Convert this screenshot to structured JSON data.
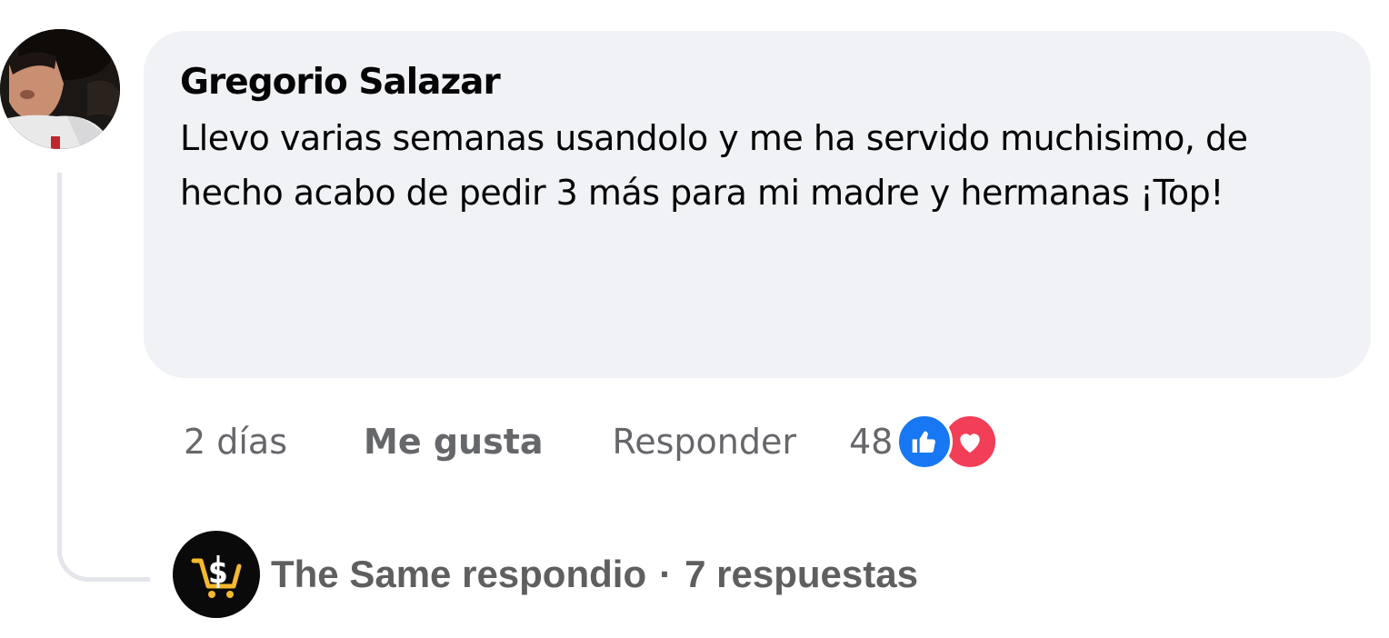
{
  "comment": {
    "author": "Gregorio Salazar",
    "text": "Llevo varias semanas usandolo y me ha servido muchisimo, de hecho acabo de pedir 3 más para mi madre y hermanas ¡Top!",
    "time": "2 días",
    "like_label": "Me gusta",
    "reply_label": "Responder",
    "reaction_count": "48",
    "reactions": [
      "like-icon",
      "love-icon"
    ]
  },
  "replies": {
    "author": "The Same",
    "action": "respondio",
    "separator": "·",
    "count_label": "7 respuestas"
  },
  "colors": {
    "bubble": "#f0f2f5",
    "like": "#1877f2",
    "love": "#f33e58",
    "muted": "#65676b",
    "brand_accent": "#f5b82e"
  }
}
